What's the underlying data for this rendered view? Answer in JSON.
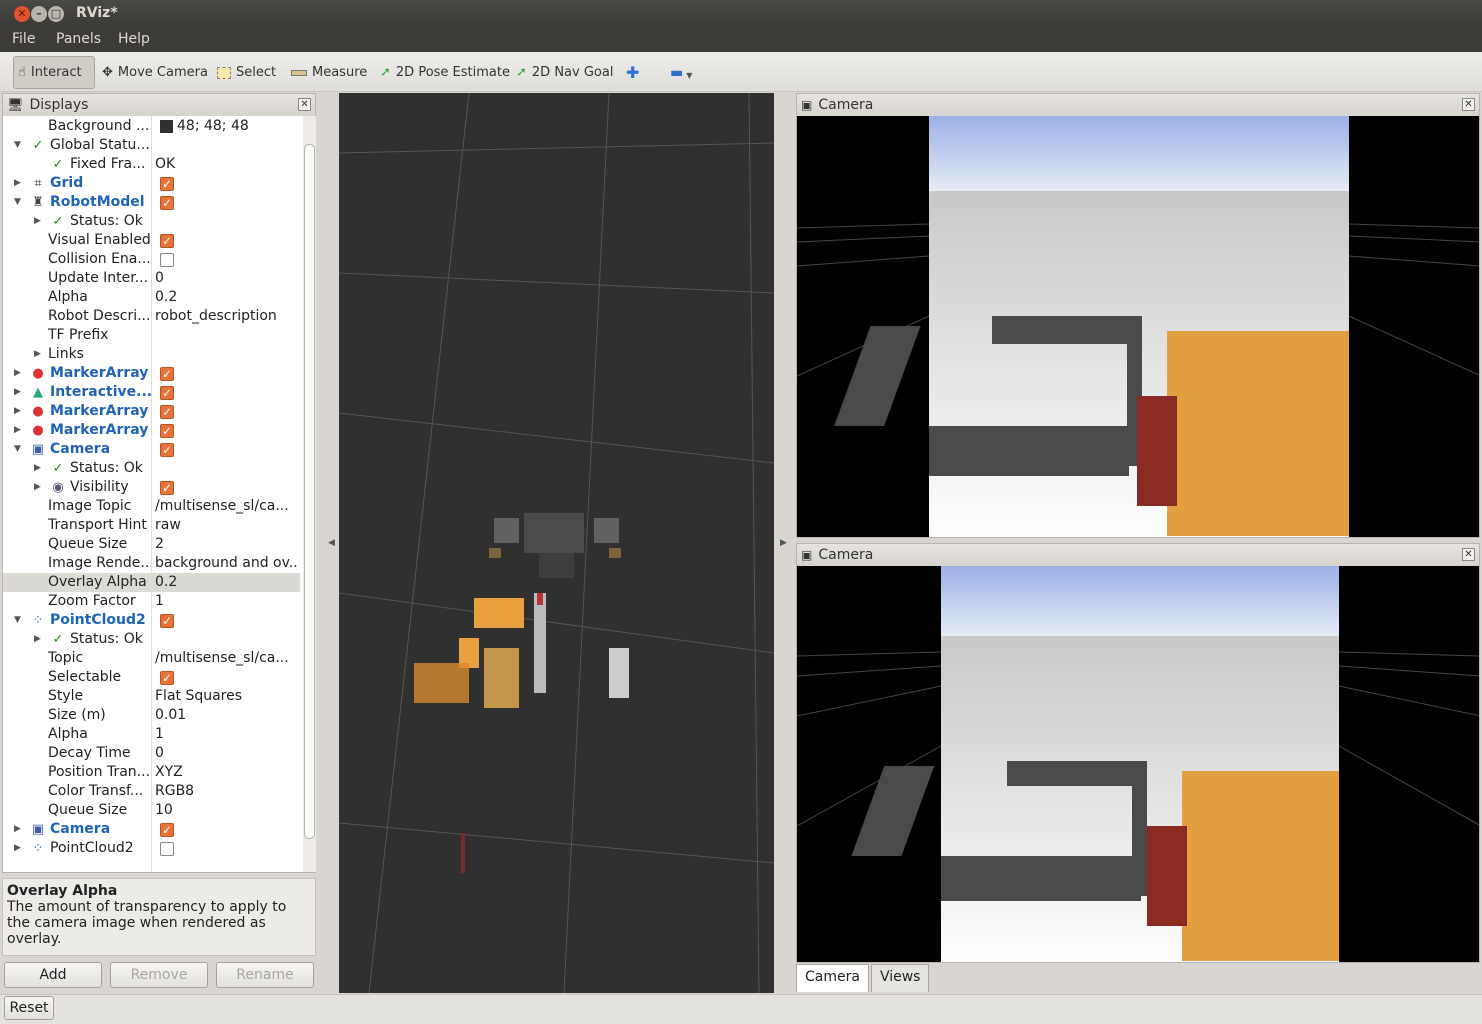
{
  "window": {
    "title": "RViz*"
  },
  "menu": {
    "file": "File",
    "panels": "Panels",
    "help": "Help"
  },
  "toolbar": {
    "interact": "Interact",
    "move_camera": "Move Camera",
    "select": "Select",
    "measure": "Measure",
    "pose_estimate": "2D Pose Estimate",
    "nav_goal": "2D Nav Goal"
  },
  "displays": {
    "title": "Displays",
    "rows": [
      {
        "name": "Background ...",
        "value": "48; 48; 48"
      },
      {
        "name": "Global Statu...",
        "value": ""
      },
      {
        "name": "Fixed Fra...",
        "value": "OK"
      },
      {
        "name": "Grid",
        "value": ""
      },
      {
        "name": "RobotModel",
        "value": ""
      },
      {
        "name": "Status: Ok",
        "value": ""
      },
      {
        "name": "Visual Enabled",
        "value": ""
      },
      {
        "name": "Collision Ena...",
        "value": ""
      },
      {
        "name": "Update Inter...",
        "value": "0"
      },
      {
        "name": "Alpha",
        "value": "0.2"
      },
      {
        "name": "Robot Descri...",
        "value": "robot_description"
      },
      {
        "name": "TF Prefix",
        "value": ""
      },
      {
        "name": "Links",
        "value": ""
      },
      {
        "name": "MarkerArray",
        "value": ""
      },
      {
        "name": "Interactive...",
        "value": ""
      },
      {
        "name": "MarkerArray",
        "value": ""
      },
      {
        "name": "MarkerArray",
        "value": ""
      },
      {
        "name": "Camera",
        "value": ""
      },
      {
        "name": "Status: Ok",
        "value": ""
      },
      {
        "name": "Visibility",
        "value": ""
      },
      {
        "name": "Image Topic",
        "value": "/multisense_sl/ca..."
      },
      {
        "name": "Transport Hint",
        "value": "raw"
      },
      {
        "name": "Queue Size",
        "value": "2"
      },
      {
        "name": "Image Rende...",
        "value": "background and ov..."
      },
      {
        "name": "Overlay Alpha",
        "value": "0.2"
      },
      {
        "name": "Zoom Factor",
        "value": "1"
      },
      {
        "name": "PointCloud2",
        "value": ""
      },
      {
        "name": "Status: Ok",
        "value": ""
      },
      {
        "name": "Topic",
        "value": "/multisense_sl/ca..."
      },
      {
        "name": "Selectable",
        "value": ""
      },
      {
        "name": "Style",
        "value": "Flat Squares"
      },
      {
        "name": "Size (m)",
        "value": "0.01"
      },
      {
        "name": "Alpha",
        "value": "1"
      },
      {
        "name": "Decay Time",
        "value": "0"
      },
      {
        "name": "Position Tran...",
        "value": "XYZ"
      },
      {
        "name": "Color Transf...",
        "value": "RGB8"
      },
      {
        "name": "Queue Size",
        "value": "10"
      },
      {
        "name": "Camera",
        "value": ""
      },
      {
        "name": "PointCloud2",
        "value": ""
      }
    ]
  },
  "description": {
    "title": "Overlay Alpha",
    "text": "The amount of transparency to apply to the camera image when rendered as overlay."
  },
  "buttons": {
    "add": "Add",
    "remove": "Remove",
    "rename": "Rename",
    "reset": "Reset"
  },
  "camera_panels": [
    {
      "title": "Camera"
    },
    {
      "title": "Camera"
    }
  ],
  "tabs": [
    "Camera",
    "Views"
  ],
  "colors": {
    "background": "#303030",
    "accent": "#1f63b6",
    "checkbox_on": "#e8733a"
  }
}
